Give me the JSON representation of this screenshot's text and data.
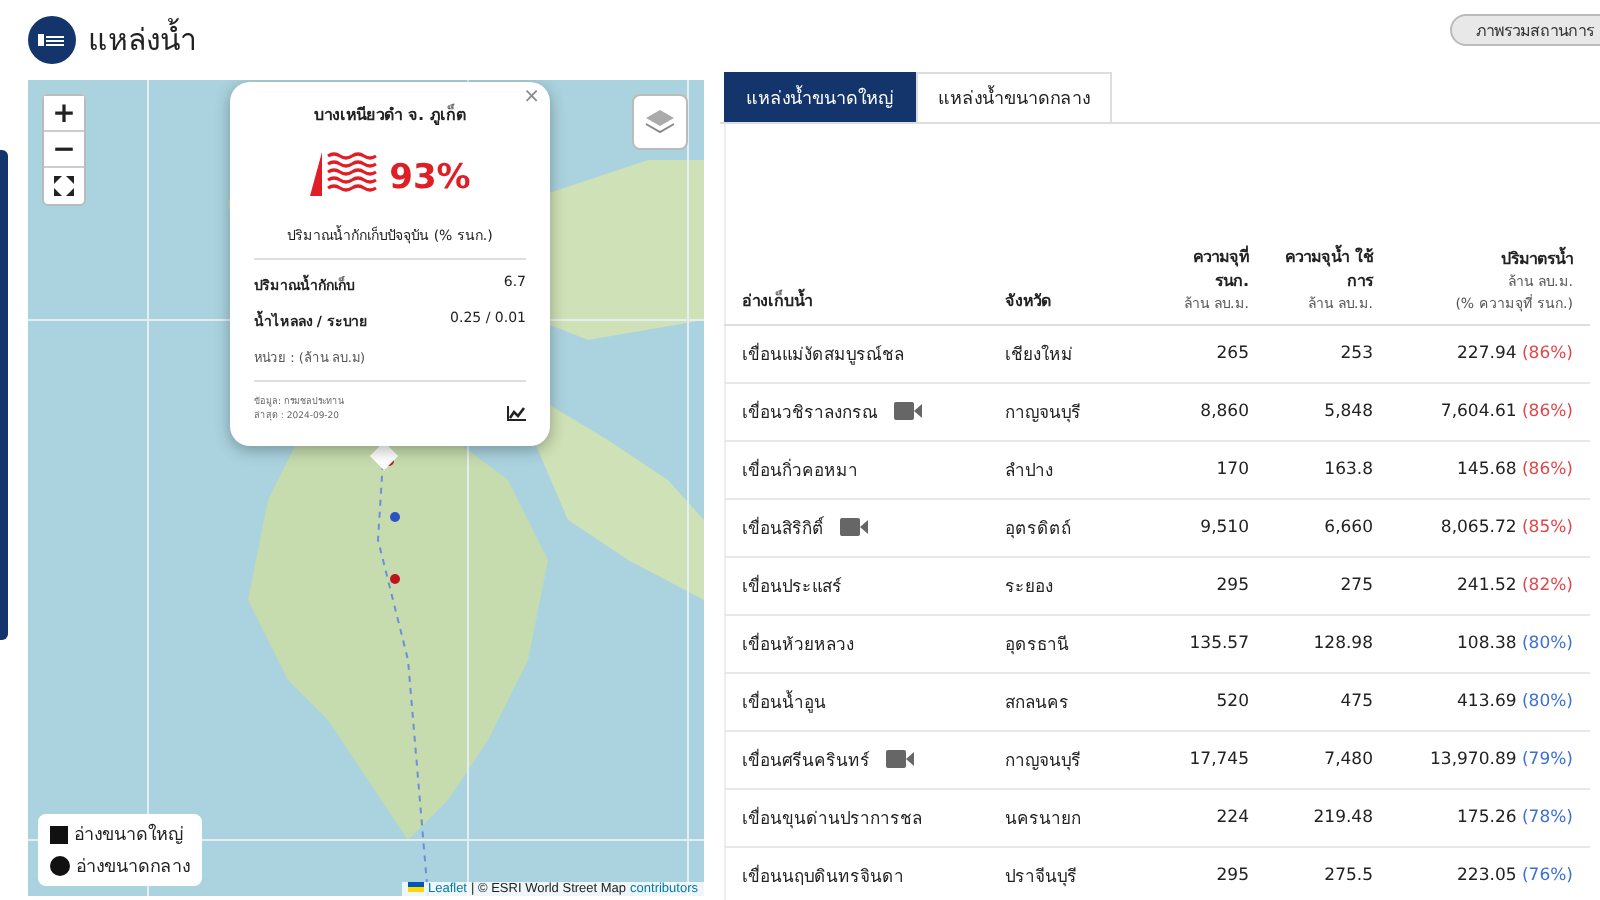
{
  "header": {
    "title": "แหล่งน้ำ",
    "overview_button": "ภาพรวมสถานการ"
  },
  "map": {
    "zoom_in": "+",
    "zoom_out": "−",
    "popup": {
      "close": "×",
      "title": "บางเหนียวดำ จ. ภูเก็ต",
      "percent": "93%",
      "subtitle": "ปริมาณน้ำกักเก็บปัจจุบัน (% รนก.)",
      "rows": [
        {
          "label": "ปริมาณน้ำกักเก็บ",
          "value": "6.7"
        },
        {
          "label": "น้ำไหลลง / ระบาย",
          "value": "0.25 / 0.01"
        }
      ],
      "unit": "หน่วย : (ล้าน ลบ.ม)",
      "source": "ข้อมูล: กรมชลประทาน",
      "updated": "ล่าสุด : 2024-09-20"
    },
    "legend": [
      {
        "kind": "square",
        "label": "อ่างขนาดใหญ่"
      },
      {
        "kind": "circle",
        "label": "อ่างขนาดกลาง"
      }
    ],
    "attribution": {
      "leaflet": "Leaflet",
      "rest": "| © ESRI World Street Map",
      "contributors": "contributors"
    }
  },
  "tabs": [
    {
      "label": "แหล่งน้ำขนาดใหญ่",
      "selected": true
    },
    {
      "label": "แหล่งน้ำขนาดกลาง",
      "selected": false
    }
  ],
  "table": {
    "columns": [
      {
        "title": "อ่างเก็บน้ำ"
      },
      {
        "title": "จังหวัด"
      },
      {
        "title": "ความจุที่ รนก.",
        "unit": "ล้าน ลบ.ม."
      },
      {
        "title": "ความจุน้ำ ใช้การ",
        "unit": "ล้าน ลบ.ม."
      },
      {
        "title": "ปริมาตรน้ำ",
        "unit": "ล้าน ลบ.ม.",
        "note": "(% ความจุที่ รนก.)"
      }
    ],
    "rows": [
      {
        "name": "เขื่อนแม่งัดสมบูรณ์ชล",
        "camera": false,
        "province": "เชียงใหม่",
        "capacity": "265",
        "usable": "253",
        "volume": "227.94",
        "percent": "(86%)",
        "color": "#e0474c"
      },
      {
        "name": "เขื่อนวชิราลงกรณ",
        "camera": true,
        "province": "กาญจนบุรี",
        "capacity": "8,860",
        "usable": "5,848",
        "volume": "7,604.61",
        "percent": "(86%)",
        "color": "#e0474c"
      },
      {
        "name": "เขื่อนกิ่วคอหมา",
        "camera": false,
        "province": "ลำปาง",
        "capacity": "170",
        "usable": "163.8",
        "volume": "145.68",
        "percent": "(86%)",
        "color": "#e0474c"
      },
      {
        "name": "เขื่อนสิริกิติ์",
        "camera": true,
        "province": "อุตรดิตถ์",
        "capacity": "9,510",
        "usable": "6,660",
        "volume": "8,065.72",
        "percent": "(85%)",
        "color": "#e0474c"
      },
      {
        "name": "เขื่อนประแสร์",
        "camera": false,
        "province": "ระยอง",
        "capacity": "295",
        "usable": "275",
        "volume": "241.52",
        "percent": "(82%)",
        "color": "#e0474c"
      },
      {
        "name": "เขื่อนห้วยหลวง",
        "camera": false,
        "province": "อุดรธานี",
        "capacity": "135.57",
        "usable": "128.98",
        "volume": "108.38",
        "percent": "(80%)",
        "color": "#3d6fd6"
      },
      {
        "name": "เขื่อนน้ำอูน",
        "camera": false,
        "province": "สกลนคร",
        "capacity": "520",
        "usable": "475",
        "volume": "413.69",
        "percent": "(80%)",
        "color": "#3d6fd6"
      },
      {
        "name": "เขื่อนศรีนครินทร์",
        "camera": true,
        "province": "กาญจนบุรี",
        "capacity": "17,745",
        "usable": "7,480",
        "volume": "13,970.89",
        "percent": "(79%)",
        "color": "#3d6fd6"
      },
      {
        "name": "เขื่อนขุนด่านปราการชล",
        "camera": false,
        "province": "นครนายก",
        "capacity": "224",
        "usable": "219.48",
        "volume": "175.26",
        "percent": "(78%)",
        "color": "#3d6fd6"
      },
      {
        "name": "เขื่อนนฤบดินทรจินดา",
        "camera": false,
        "province": "ปราจีนบุรี",
        "capacity": "295",
        "usable": "275.5",
        "volume": "223.05",
        "percent": "(76%)",
        "color": "#3d6fd6"
      }
    ]
  }
}
